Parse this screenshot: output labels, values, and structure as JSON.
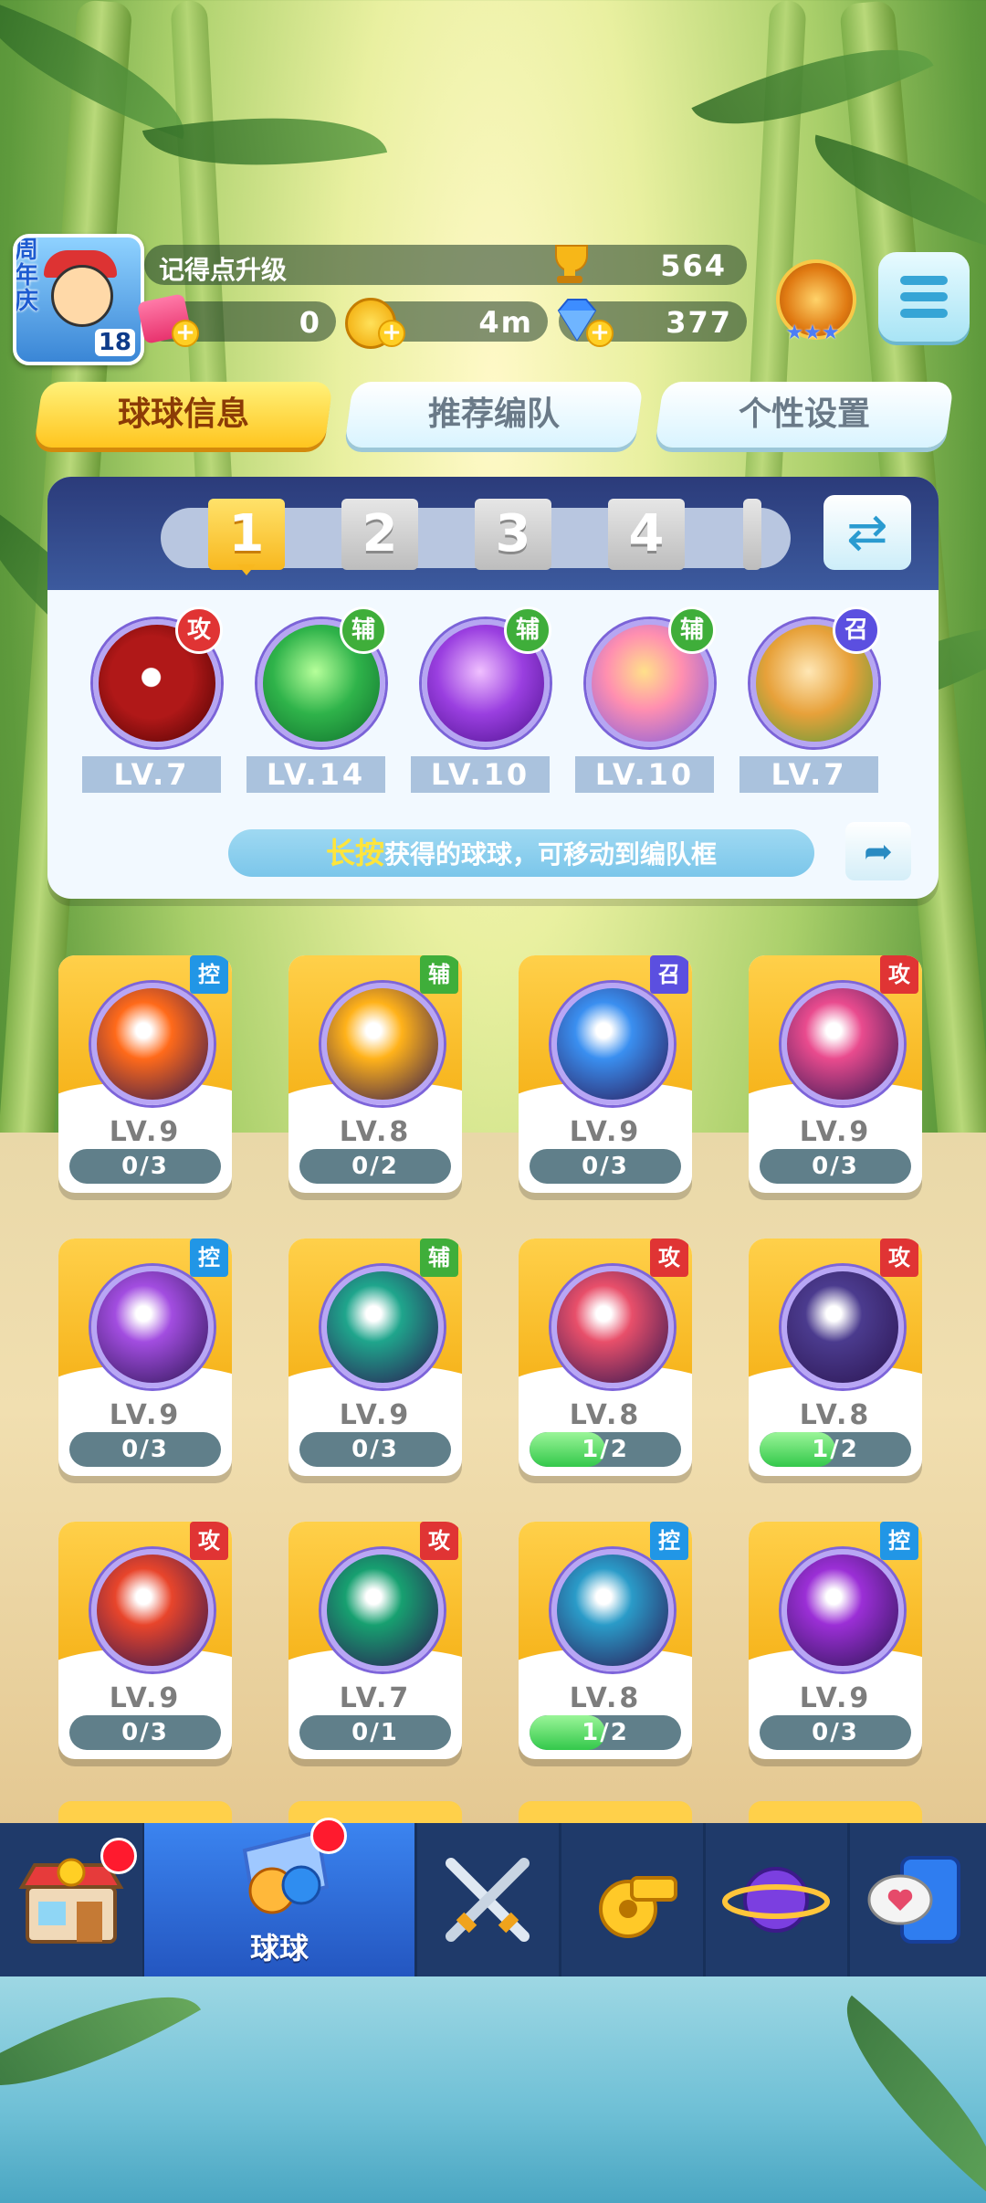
{
  "player": {
    "anniv_label": "周年庆",
    "days": "18"
  },
  "header": {
    "title": "记得点升级",
    "trophy_value": "564",
    "tickets": "0",
    "coins": "4m",
    "gems": "377"
  },
  "tabs": [
    "球球信息",
    "推荐编队",
    "个性设置"
  ],
  "team": {
    "slots": [
      "1",
      "2",
      "3",
      "4"
    ],
    "balls": [
      {
        "role": "攻",
        "level": "LV.7"
      },
      {
        "role": "辅",
        "level": "LV.14"
      },
      {
        "role": "辅",
        "level": "LV.10"
      },
      {
        "role": "辅",
        "level": "LV.10"
      },
      {
        "role": "召",
        "level": "LV.7"
      }
    ],
    "hint_em": "长按",
    "hint_rest": "获得的球球，可移动到编队框"
  },
  "cards": [
    {
      "role": "控",
      "level": "LV.9",
      "progress": "0/3",
      "fill": 0,
      "color": "#ff6a1a"
    },
    {
      "role": "辅",
      "level": "LV.8",
      "progress": "0/2",
      "fill": 0,
      "color": "#ffb21a"
    },
    {
      "role": "召",
      "level": "LV.9",
      "progress": "0/3",
      "fill": 0,
      "color": "#3a8ff0"
    },
    {
      "role": "攻",
      "level": "LV.9",
      "progress": "0/3",
      "fill": 0,
      "color": "#e94b8e"
    },
    {
      "role": "控",
      "level": "LV.9",
      "progress": "0/3",
      "fill": 0,
      "color": "#a24de0"
    },
    {
      "role": "辅",
      "level": "LV.9",
      "progress": "0/3",
      "fill": 0,
      "color": "#1fa58c"
    },
    {
      "role": "攻",
      "level": "LV.8",
      "progress": "1/2",
      "fill": 0.5,
      "color": "#e84f6a"
    },
    {
      "role": "攻",
      "level": "LV.8",
      "progress": "1/2",
      "fill": 0.5,
      "color": "#4b3b8e"
    },
    {
      "role": "攻",
      "level": "LV.9",
      "progress": "0/3",
      "fill": 0,
      "color": "#e8452b"
    },
    {
      "role": "攻",
      "level": "LV.7",
      "progress": "0/1",
      "fill": 0,
      "color": "#17a070"
    },
    {
      "role": "控",
      "level": "LV.8",
      "progress": "1/2",
      "fill": 0.5,
      "color": "#2a9bc8"
    },
    {
      "role": "控",
      "level": "LV.9",
      "progress": "0/3",
      "fill": 0,
      "color": "#9b2fd6"
    }
  ],
  "nav": {
    "items": [
      "shop-icon",
      "balls-icon",
      "battle-icon",
      "whistle-icon",
      "planet-icon",
      "chat-icon"
    ],
    "active_label": "球球"
  }
}
